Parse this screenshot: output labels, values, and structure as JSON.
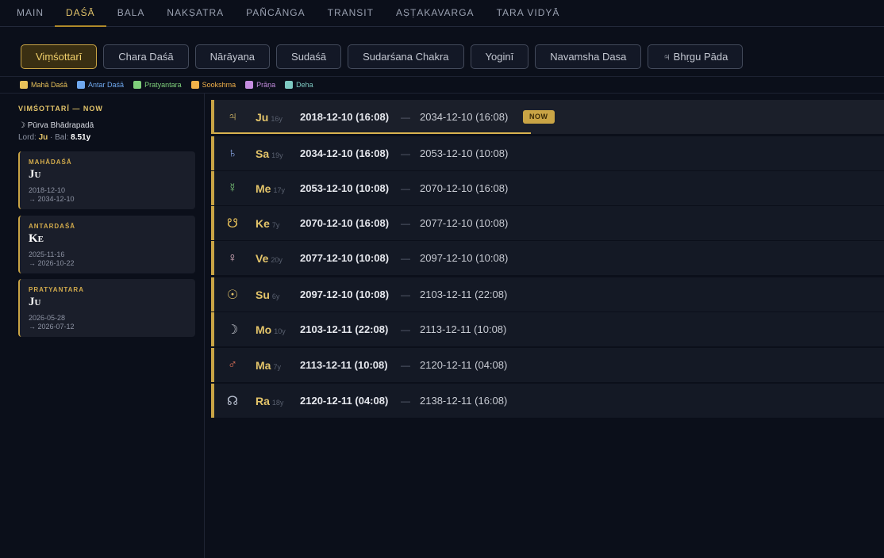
{
  "nav": {
    "tabs": [
      {
        "label": "MAIN",
        "active": false
      },
      {
        "label": "DAŚĀ",
        "active": true
      },
      {
        "label": "BALA",
        "active": false
      },
      {
        "label": "NAKṢATRA",
        "active": false
      },
      {
        "label": "PAÑCĀNGA",
        "active": false
      },
      {
        "label": "TRANSIT",
        "active": false
      },
      {
        "label": "AṢṬAKAVARGA",
        "active": false
      },
      {
        "label": "TARA VIDYĀ",
        "active": false
      }
    ]
  },
  "dasha_buttons": [
    {
      "label": "Viṃśottarī",
      "active": true
    },
    {
      "label": "Chara Daśā",
      "active": false
    },
    {
      "label": "Nārāyaṇa",
      "active": false
    },
    {
      "label": "Sudaśā",
      "active": false
    },
    {
      "label": "Sudarśana Chakra",
      "active": false
    },
    {
      "label": "Yoginī",
      "active": false
    },
    {
      "label": "Navamsha Dasa",
      "active": false
    },
    {
      "label": "♃ Bhṛgu Pāda",
      "active": false
    }
  ],
  "legend": [
    {
      "label": "Mahā Daśā",
      "color": "#e8c15a"
    },
    {
      "label": "Antar Daśā",
      "color": "#6fa8ef"
    },
    {
      "label": "Pratyantara",
      "color": "#7fcf7b"
    },
    {
      "label": "Sookshma",
      "color": "#f2b14a"
    },
    {
      "label": "Prāṇa",
      "color": "#c58de0"
    },
    {
      "label": "Deha",
      "color": "#7ec9c2"
    }
  ],
  "left_panel": {
    "heading": "VIMŚOTTARĪ — NOW",
    "nakshatra": "☽ Pūrva Bhādrapadā",
    "lord_label": "Lord:",
    "lord_value": "Ju",
    "bal_label": "· Bal:",
    "bal_value": "8.51y",
    "cards": [
      {
        "label": "MAHĀDAŚĀ",
        "lord": "Ju",
        "start": "2018-12-10",
        "end": "→ 2034-12-10"
      },
      {
        "label": "ANTARDAŚĀ",
        "lord": "Ke",
        "start": "2025-11-16",
        "end": "→ 2026-10-22"
      },
      {
        "label": "PRATYANTARA",
        "lord": "Ju",
        "start": "2026-05-28",
        "end": "→ 2026-07-12"
      }
    ]
  },
  "rows": [
    {
      "glyph": "♃",
      "glyph_icon": "jupiter-icon",
      "color": "#e3c46a",
      "lord": "Ju",
      "years": "16y",
      "start": "2018-12-10 (16:08)",
      "end": "2034-12-10 (16:08)",
      "now": "NOW",
      "progress": 0.47
    },
    {
      "glyph": "♄",
      "glyph_icon": "saturn-icon",
      "color": "#8aa7e6",
      "lord": "Sa",
      "years": "19y",
      "start": "2034-12-10 (16:08)",
      "end": "2053-12-10 (10:08)"
    },
    {
      "glyph": "☿",
      "glyph_icon": "mercury-icon",
      "color": "#7fcf7b",
      "lord": "Me",
      "years": "17y",
      "start": "2053-12-10 (10:08)",
      "end": "2070-12-10 (16:08)"
    },
    {
      "glyph": "☋",
      "glyph_icon": "ketu-icon",
      "color": "#e8c15a",
      "lord": "Ke",
      "years": "7y",
      "start": "2070-12-10 (16:08)",
      "end": "2077-12-10 (10:08)"
    },
    {
      "glyph": "♀",
      "glyph_icon": "venus-icon",
      "color": "#e8b9c9",
      "lord": "Ve",
      "years": "20y",
      "start": "2077-12-10 (10:08)",
      "end": "2097-12-10 (10:08)"
    },
    {
      "glyph": "☉",
      "glyph_icon": "sun-icon",
      "color": "#e3c46a",
      "lord": "Su",
      "years": "6y",
      "start": "2097-12-10 (10:08)",
      "end": "2103-12-11 (22:08)"
    },
    {
      "glyph": "☽",
      "glyph_icon": "moon-icon",
      "color": "#c9ccd4",
      "lord": "Mo",
      "years": "10y",
      "start": "2103-12-11 (22:08)",
      "end": "2113-12-11 (10:08)"
    },
    {
      "glyph": "♂",
      "glyph_icon": "mars-icon",
      "color": "#e2735a",
      "lord": "Ma",
      "years": "7y",
      "start": "2113-12-11 (10:08)",
      "end": "2120-12-11 (04:08)"
    },
    {
      "glyph": "☊",
      "glyph_icon": "rahu-icon",
      "color": "#b9c0d0",
      "lord": "Ra",
      "years": "18y",
      "start": "2120-12-11 (04:08)",
      "end": "2138-12-11 (16:08)"
    }
  ]
}
